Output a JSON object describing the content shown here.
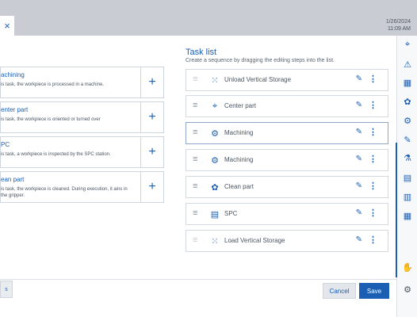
{
  "header": {
    "close_icon": "×",
    "date": "1/26/2024",
    "time": "11:09 AM"
  },
  "sidebar_icons": [
    "⌖",
    "⚠",
    "▦",
    "✿",
    "⚙",
    "✎",
    "⚗",
    "▤",
    "▥",
    "▦",
    "✋",
    "⚙"
  ],
  "available_steps": [
    {
      "title": "achining",
      "desc": "is task, the workpiece is processed in a machine."
    },
    {
      "title": "enter part",
      "desc": "is task, the workpiece is oriented or turned over"
    },
    {
      "title": "PC",
      "desc": "is task, a workpiece is inspected by the SPC station."
    },
    {
      "title": "ean part",
      "desc": "is task, the workpiece is cleaned. During execution, it ains in the gripper."
    }
  ],
  "add_label": "+",
  "task_list": {
    "title": "Task list",
    "subtitle": "Create a sequence by dragging the editing steps into the list.",
    "items": [
      {
        "name": "Unload Vertical Storage",
        "icon": "⁙"
      },
      {
        "name": "Center part",
        "icon": "⌖"
      },
      {
        "name": "Machining",
        "icon": "⚙"
      },
      {
        "name": "Machining",
        "icon": "⚙"
      },
      {
        "name": "Clean part",
        "icon": "✿"
      },
      {
        "name": "SPC",
        "icon": "▤"
      },
      {
        "name": "Load Vertical Storage",
        "icon": "⁙"
      }
    ]
  },
  "glyphs": {
    "drag": "≡",
    "edit": "✎",
    "more": "⋮"
  },
  "footer": {
    "left_label": "s",
    "cancel": "Cancel",
    "save": "Save"
  }
}
